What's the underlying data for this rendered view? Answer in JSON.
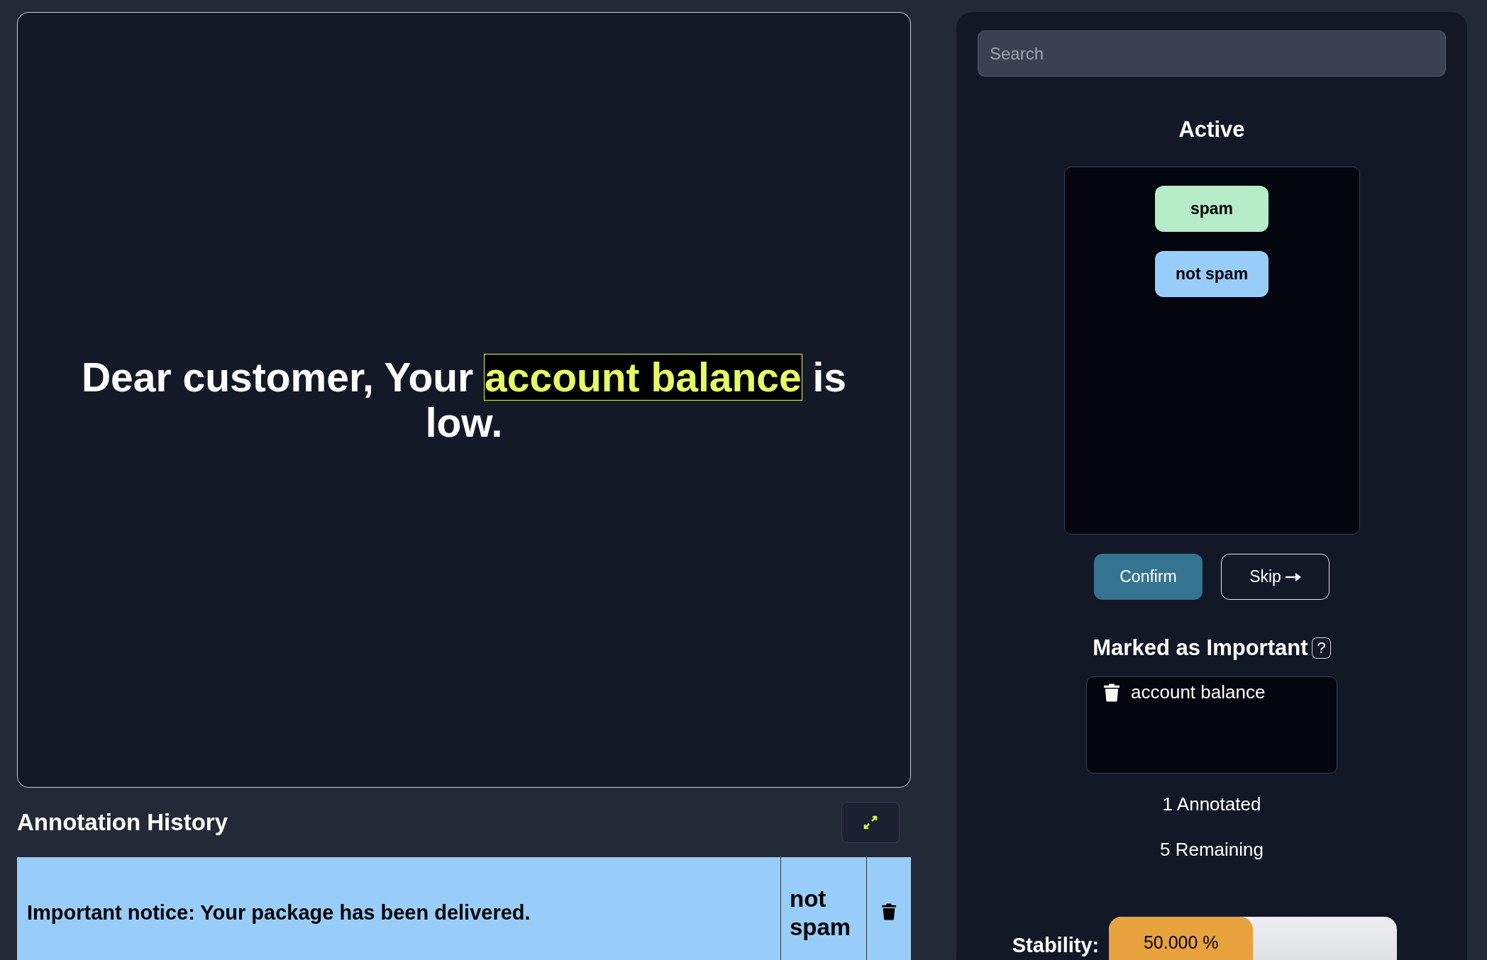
{
  "message": {
    "segments": [
      {
        "text": "Dear customer, Your ",
        "highlighted": false
      },
      {
        "text": "account balance",
        "highlighted": true
      },
      {
        "text": " is low.",
        "highlighted": false
      }
    ]
  },
  "history": {
    "title": "Annotation History",
    "rows": [
      {
        "text": "Important notice: Your package has been delivered.",
        "label": "not spam",
        "color": "#99cdf9"
      }
    ]
  },
  "search": {
    "placeholder": "Search"
  },
  "active": {
    "title": "Active",
    "labels": [
      {
        "text": "spam",
        "color": "#b6ecc8"
      },
      {
        "text": "not spam",
        "color": "#99cdf9"
      }
    ]
  },
  "buttons": [
    {
      "text": "Confirm",
      "kind": "primary"
    },
    {
      "text": "Skip",
      "kind": "skip"
    }
  ],
  "important": {
    "title": "Marked as Important",
    "help": "?",
    "items": [
      "account balance"
    ]
  },
  "counts": [
    "1 Annotated",
    "5 Remaining"
  ],
  "stability": {
    "label": "Stability:",
    "reading": "50.000 %",
    "level": 0.5
  }
}
